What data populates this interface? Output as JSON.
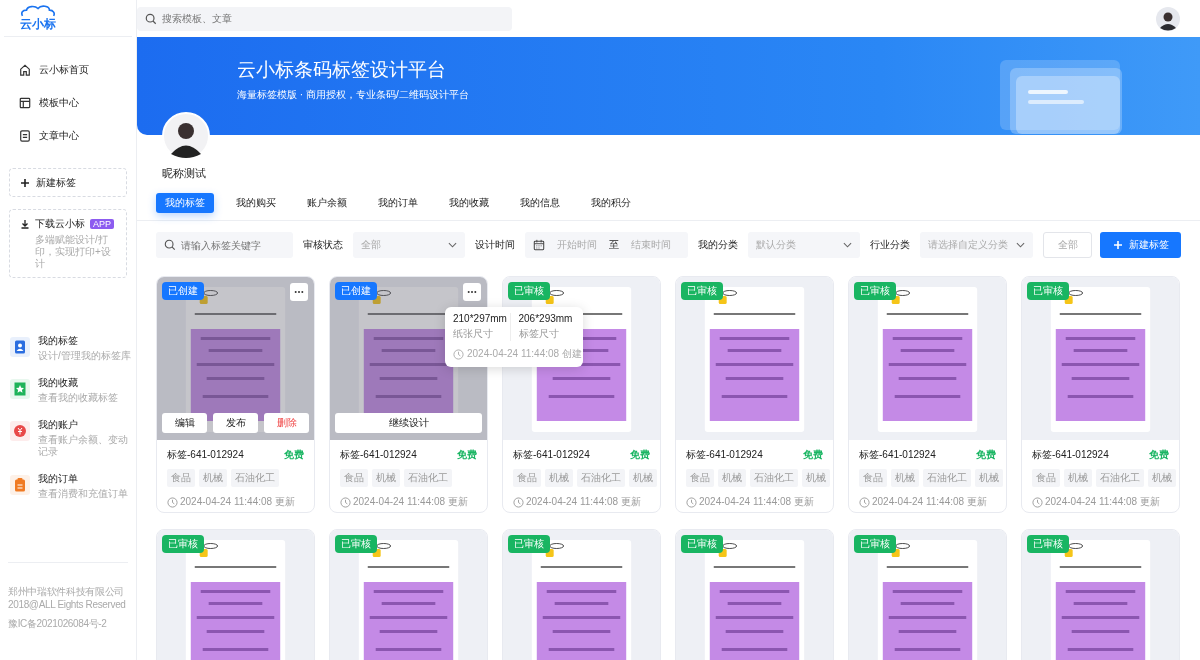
{
  "header": {
    "logo": "云小标",
    "search_placeholder": "搜索模板、文章"
  },
  "nav": [
    {
      "label": "云小标首页",
      "kind": "home"
    },
    {
      "label": "模板中心",
      "kind": "template"
    },
    {
      "label": "文章中心",
      "kind": "article"
    }
  ],
  "new_label_button": "新建标签",
  "download": {
    "title": "下载云小标",
    "badge": "APP",
    "description": "多端赋能设计/打印，实现打印+设计"
  },
  "menu": [
    {
      "title": "我的标签",
      "subtitle": "设计/管理我的标签库",
      "kind": "person",
      "color": "#2a6de0"
    },
    {
      "title": "我的收藏",
      "subtitle": "查看我的收藏标签",
      "kind": "star",
      "color": "#1fb35a"
    },
    {
      "title": "我的账户",
      "subtitle": "查看账户余额、变动记录",
      "kind": "money",
      "color": "#e84848"
    },
    {
      "title": "我的订单",
      "subtitle": "查看消费和充值订单",
      "kind": "order",
      "color": "#f07a22"
    }
  ],
  "footer": [
    "郑州中瑞软件科技有限公司",
    "2018@ALL Eights Reserved",
    "豫IC备2021026084号-2"
  ],
  "banner": {
    "title": "云小标条码标签设计平台",
    "subtitle": "海量标签模版 · 商用授权，专业条码/二维码设计平台"
  },
  "profile": {
    "nickname": "昵称测试"
  },
  "tabs": [
    {
      "label": "我的标签",
      "selected": true
    },
    {
      "label": "我的购买",
      "selected": false
    },
    {
      "label": "账户余额",
      "selected": false
    },
    {
      "label": "我的订单",
      "selected": false
    },
    {
      "label": "我的收藏",
      "selected": false
    },
    {
      "label": "我的信息",
      "selected": false
    },
    {
      "label": "我的积分",
      "selected": false
    }
  ],
  "filters": {
    "keyword_placeholder": "请输入标签关键字",
    "status_label": "审核状态",
    "status_value": "全部",
    "time_label": "设计时间",
    "start_placeholder": "开始时间",
    "range_separator": "至",
    "end_placeholder": "结束时间",
    "my_category_label": "我的分类",
    "my_category_placeholder": "默认分类",
    "industry_label": "行业分类",
    "industry_placeholder": "请选择自定义分类",
    "all_button": "全部",
    "new_button": "新建标签"
  },
  "cards": [
    {
      "status": "已创建",
      "kind": "created",
      "hovered": true,
      "actions": [
        {
          "label": "编辑",
          "danger": false
        },
        {
          "label": "发布",
          "danger": false
        },
        {
          "label": "删除",
          "danger": true
        }
      ],
      "title": "标签-641-012924",
      "price": "免费",
      "tags": [
        "食品",
        "机械",
        "石油化工"
      ],
      "updated": "2024-04-24 11:44:08 更新"
    },
    {
      "status": "已创建",
      "kind": "created",
      "hovered": true,
      "actions": [
        {
          "label": "继续设计",
          "danger": false
        }
      ],
      "title": "标签-641-012924",
      "price": "免费",
      "tags": [
        "食品",
        "机械",
        "石油化工"
      ],
      "updated": "2024-04-24 11:44:08 更新"
    },
    {
      "status": "已审核",
      "kind": "approved",
      "hovered": false,
      "title": "标签-641-012924",
      "price": "免费",
      "tags": [
        "食品",
        "机械",
        "石油化工",
        "机械"
      ],
      "updated": "2024-04-24 11:44:08 更新"
    },
    {
      "status": "已审核",
      "kind": "approved",
      "hovered": false,
      "title": "标签-641-012924",
      "price": "免费",
      "tags": [
        "食品",
        "机械",
        "石油化工",
        "机械"
      ],
      "updated": "2024-04-24 11:44:08 更新"
    },
    {
      "status": "已审核",
      "kind": "approved",
      "hovered": false,
      "title": "标签-641-012924",
      "price": "免费",
      "tags": [
        "食品",
        "机械",
        "石油化工",
        "机械"
      ],
      "updated": "2024-04-24 11:44:08 更新"
    },
    {
      "status": "已审核",
      "kind": "approved",
      "hovered": false,
      "title": "标签-641-012924",
      "price": "免费",
      "tags": [
        "食品",
        "机械",
        "石油化工",
        "机械"
      ],
      "updated": "2024-04-24 11:44:08 更新"
    },
    {
      "status": "已审核",
      "kind": "approved",
      "hovered": false
    },
    {
      "status": "已审核",
      "kind": "approved",
      "hovered": false
    },
    {
      "status": "已审核",
      "kind": "approved",
      "hovered": false
    },
    {
      "status": "已审核",
      "kind": "approved",
      "hovered": false
    },
    {
      "status": "已审核",
      "kind": "approved",
      "hovered": false
    },
    {
      "status": "已审核",
      "kind": "approved",
      "hovered": false
    }
  ],
  "tooltip": {
    "paper_size": "210*297mm",
    "paper_label": "纸张尺寸",
    "label_size": "206*293mm",
    "label_label": "标签尺寸",
    "created": "2024-04-24 11:44:08 创建"
  }
}
